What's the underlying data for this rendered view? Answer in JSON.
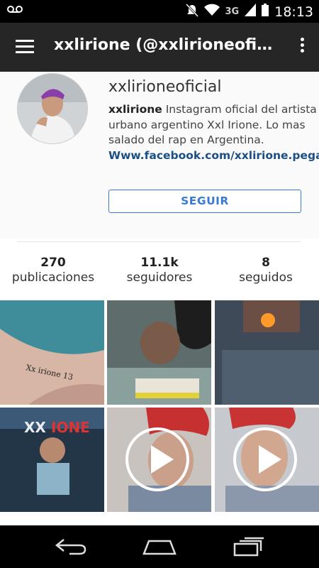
{
  "status_bar": {
    "network": "3G",
    "time": "18:13"
  },
  "app_bar": {
    "title": "xxlirione (@xxlirioneoficial)..."
  },
  "profile": {
    "username": "xxlirioneoficial",
    "bio_name": "xxlirione",
    "bio_text": " Instagram oficial del artista urbano argentino Xxl Irione. Lo mas salado del rap en Argentina.",
    "link": "Www.facebook.com/xxlirione.pegadura",
    "follow_label": "SEGUIR"
  },
  "stats": [
    {
      "value": "270",
      "label": "publicaciones"
    },
    {
      "value": "11.1k",
      "label": "seguidores"
    },
    {
      "value": "8",
      "label": "seguidos"
    }
  ],
  "grid": {
    "tiles": [
      {
        "kind": "photo",
        "description": "tattoo"
      },
      {
        "kind": "photo",
        "description": "writing"
      },
      {
        "kind": "photo",
        "description": "fire"
      },
      {
        "kind": "photo",
        "description": "cover"
      },
      {
        "kind": "video",
        "description": "selfie-video"
      },
      {
        "kind": "video",
        "description": "selfie-video"
      }
    ]
  }
}
